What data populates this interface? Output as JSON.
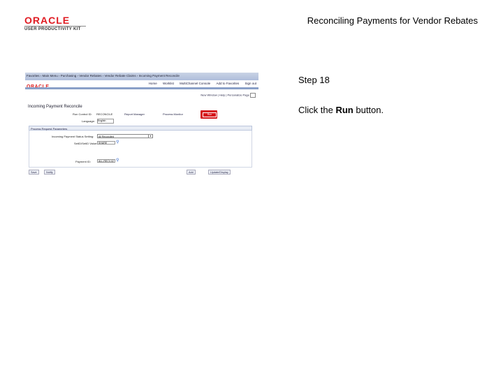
{
  "logo": {
    "brand": "ORACLE",
    "product": "USER PRODUCTIVITY KIT"
  },
  "document": {
    "title": "Reconciling Payments for Vendor Rebates"
  },
  "step": {
    "label": "Step 18",
    "instruction_prefix": "Click the ",
    "instruction_target": "Run",
    "instruction_suffix": " button."
  },
  "app": {
    "breadcrumb": "Favorites  ›  Main Menu  ›  Purchasing  ›  Vendor Rebates  ›  Vendor Rebate Claims  ›  Incoming Payment Reconcile",
    "brand": "ORACLE",
    "nav_links": [
      "Home",
      "Worklist",
      "MultiChannel Console",
      "Add to Favorites",
      "Sign out"
    ],
    "window_links": "New Window  |  Help  |  Personalize Page",
    "page_title": "Incoming Payment Reconcile",
    "run_control_label": "Run Control ID:",
    "run_control_value": "RECONCILE",
    "report_manager": "Report Manager",
    "process_monitor": "Process Monitor",
    "run_button": "Run",
    "language_label": "Language:",
    "language_value": "English",
    "section_title": "Process Request Parameters",
    "status_label": "Incoming Payment Status Setting:",
    "status_value": "All Reconciled",
    "setid_label": "SetID/SetID Value:",
    "setid_value": "SHARE",
    "payment_id_label": "Payment ID:",
    "payment_id_value": "ALL-RECV-02",
    "bottom_buttons": [
      "Save",
      "Notify",
      "Add",
      "Update/Display"
    ]
  }
}
